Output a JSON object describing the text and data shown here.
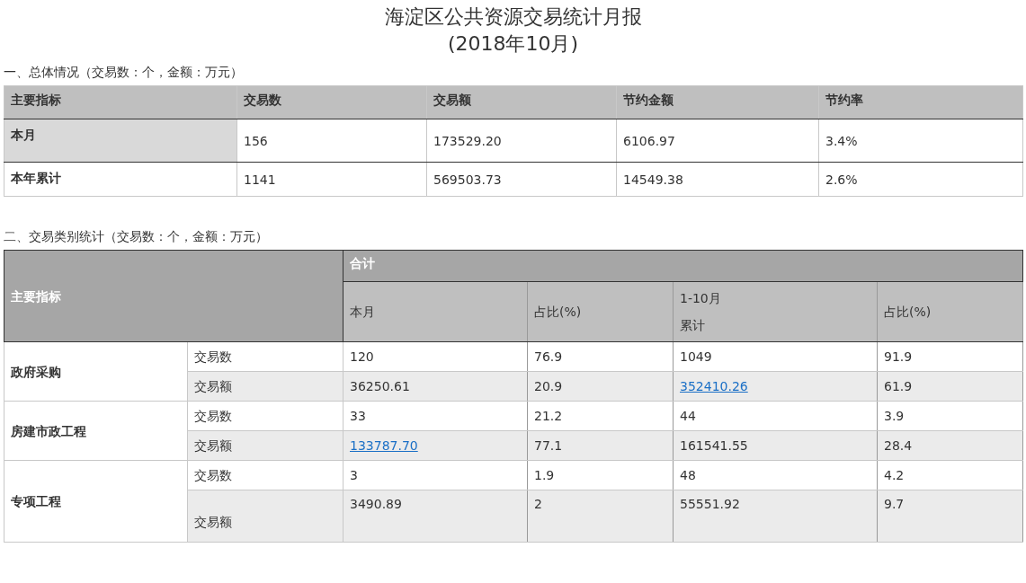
{
  "title": "海淀区公共资源交易统计月报",
  "subtitle": "(2018年10月)",
  "overview": {
    "heading": "一、总体情况（交易数：个，金额：万元）",
    "columns": [
      "主要指标",
      "交易数",
      "交易额",
      "节约金额",
      "节约率"
    ],
    "rows": [
      {
        "highlighted": true,
        "cells": [
          "本月",
          "156",
          "173529.20",
          "6106.97",
          "3.4%"
        ]
      },
      {
        "highlighted": false,
        "cells": [
          "本年累计",
          "1141",
          "569503.73",
          "14549.38",
          "2.6%"
        ]
      }
    ]
  },
  "categories": {
    "heading": "二、交易类别统计（交易数：个，金额：万元）",
    "row_header": "主要指标",
    "group_header": "合计",
    "columns": [
      {
        "lines": [
          "本月"
        ]
      },
      {
        "lines": [
          "占比(%)"
        ]
      },
      {
        "lines": [
          "1-10月",
          "累计"
        ]
      },
      {
        "lines": [
          "占比(%)"
        ]
      }
    ],
    "groups": [
      {
        "name": "政府采购",
        "rows": [
          {
            "label": "交易数",
            "cells": [
              {
                "text": "120",
                "kind": "text"
              },
              {
                "text": "76.9",
                "kind": "text"
              },
              {
                "text": "1049",
                "kind": "text"
              },
              {
                "text": "91.9",
                "kind": "text"
              }
            ]
          },
          {
            "label": "交易额",
            "cells": [
              {
                "text": "36250.61",
                "kind": "text"
              },
              {
                "text": "20.9",
                "kind": "text"
              },
              {
                "text": "352410.26",
                "kind": "link"
              },
              {
                "text": "61.9",
                "kind": "text"
              }
            ]
          }
        ]
      },
      {
        "name": "房建市政工程",
        "rows": [
          {
            "label": "交易数",
            "cells": [
              {
                "text": "33",
                "kind": "text"
              },
              {
                "text": "21.2",
                "kind": "text"
              },
              {
                "text": "44",
                "kind": "text"
              },
              {
                "text": "3.9",
                "kind": "text"
              }
            ]
          },
          {
            "label": "交易额",
            "cells": [
              {
                "text": "133787.70",
                "kind": "link"
              },
              {
                "text": "77.1",
                "kind": "text"
              },
              {
                "text": "161541.55",
                "kind": "text"
              },
              {
                "text": "28.4",
                "kind": "text"
              }
            ]
          }
        ]
      },
      {
        "name": "专项工程",
        "rows": [
          {
            "label": "交易数",
            "cells": [
              {
                "text": "3",
                "kind": "text"
              },
              {
                "text": "1.9",
                "kind": "text"
              },
              {
                "text": "48",
                "kind": "text"
              },
              {
                "text": "4.2",
                "kind": "text"
              }
            ]
          },
          {
            "label": "交易额",
            "cells": [
              {
                "text": "3490.89",
                "kind": "text"
              },
              {
                "text": "2",
                "kind": "text"
              },
              {
                "text": "55551.92",
                "kind": "text"
              },
              {
                "text": "9.7",
                "kind": "text"
              }
            ]
          }
        ]
      }
    ]
  }
}
